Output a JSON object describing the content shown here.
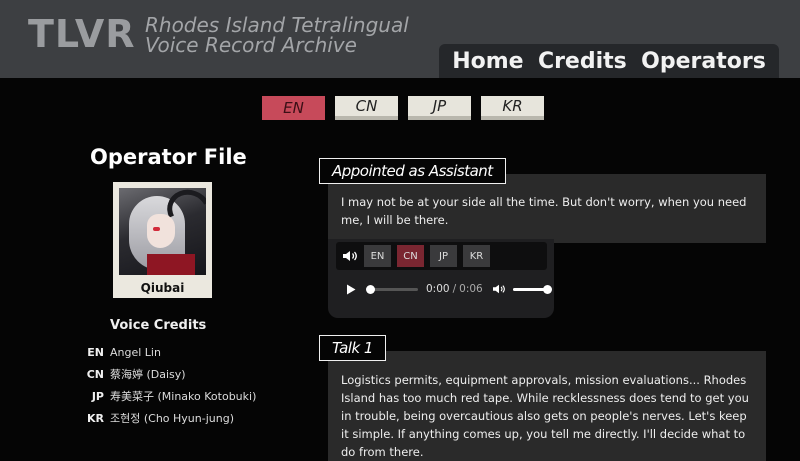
{
  "header": {
    "logo": "TLVR",
    "subtitle_line1": "Rhodes Island Tetralingual",
    "subtitle_line2": "Voice Record Archive",
    "nav": [
      "Home",
      "Credits",
      "Operators"
    ]
  },
  "languages": {
    "tabs": [
      "EN",
      "CN",
      "JP",
      "KR"
    ],
    "selected": "EN"
  },
  "operator": {
    "section_title": "Operator File",
    "name": "Qiubai",
    "portrait_icon": "operator-portrait"
  },
  "voice_credits": {
    "title": "Voice Credits",
    "rows": [
      {
        "lang": "EN",
        "name": "Angel Lin"
      },
      {
        "lang": "CN",
        "name": "蔡海婷 (Daisy)"
      },
      {
        "lang": "JP",
        "name": "寿美菜子 (Minako Kotobuki)"
      },
      {
        "lang": "KR",
        "name": "조현정 (Cho Hyun-jung)"
      }
    ]
  },
  "entries": [
    {
      "label": "Appointed as Assistant",
      "text": "I may not be at your side all the time. But don't worry, when you need me, I will be there.",
      "audio": {
        "lang_buttons": [
          "EN",
          "CN",
          "JP",
          "KR"
        ],
        "selected": "CN",
        "current_time": "0:00",
        "separator": "/",
        "duration": "0:06",
        "progress": 0,
        "volume": 1.0,
        "icons": {
          "speaker": "speaker-icon",
          "play": "play-icon",
          "volume": "volume-icon"
        }
      }
    },
    {
      "label": "Talk 1",
      "text": "Logistics permits, equipment approvals, mission evaluations... Rhodes Island has too much red tape. While recklessness does tend to get you in trouble, being overcautious also gets on people's nerves. Let's keep it simple. If anything comes up, you tell me directly. I'll decide what to do from there."
    }
  ],
  "colors": {
    "header_bg": "#3d3f42",
    "nav_bg": "#25272a",
    "accent_tab": "#c74a5a",
    "audio_selected": "#7a2631",
    "panel_bg": "#2a2a2a"
  }
}
